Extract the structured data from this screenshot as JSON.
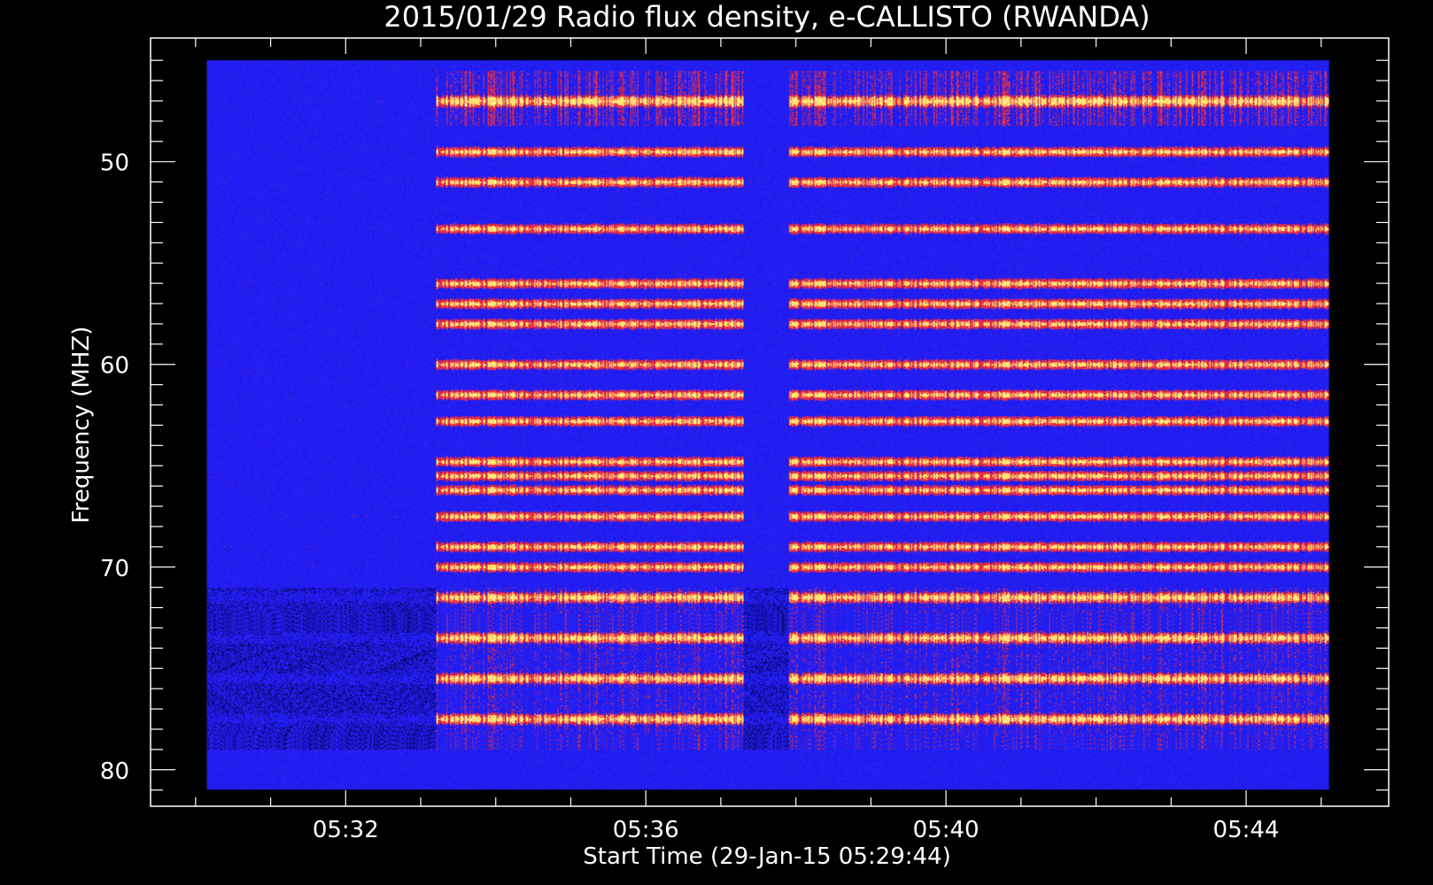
{
  "chart_data": {
    "type": "heatmap",
    "title": "2015/01/29  Radio flux density, e-CALLISTO (RWANDA)",
    "xlabel": "Start Time (29-Jan-15 05:29:44)",
    "ylabel": "Frequency (MHZ)",
    "x_tick_labels": [
      "05:32",
      "05:36",
      "05:40",
      "05:44"
    ],
    "x_ticks_min": [
      32,
      36,
      40,
      44
    ],
    "y_ticks": [
      50,
      60,
      70,
      80
    ],
    "xlim_min": [
      29.4,
      45.9
    ],
    "ylim": [
      81.8,
      43.9
    ],
    "data_xlim_min": [
      30.15,
      45.1
    ],
    "data_ylim": [
      81.0,
      45.0
    ],
    "y_inverted": true,
    "colorscale": [
      "#000000",
      "#1a1aa0",
      "#2a2aff",
      "#ff2a00",
      "#ffff80"
    ],
    "active_intervals_min": [
      [
        33.2,
        37.3
      ],
      [
        37.9,
        45.1
      ]
    ],
    "bright_bands_mhz": [
      47,
      49.5,
      51,
      53.3,
      56,
      57,
      58,
      60,
      61.5,
      62.8,
      64.8,
      65.5,
      66.2,
      67.5,
      69,
      70,
      71.5,
      73.5,
      75.5,
      77.5
    ],
    "burst_region_mhz": [
      71,
      79
    ],
    "background_color": "#000000",
    "axis_color": "#ffffff"
  }
}
